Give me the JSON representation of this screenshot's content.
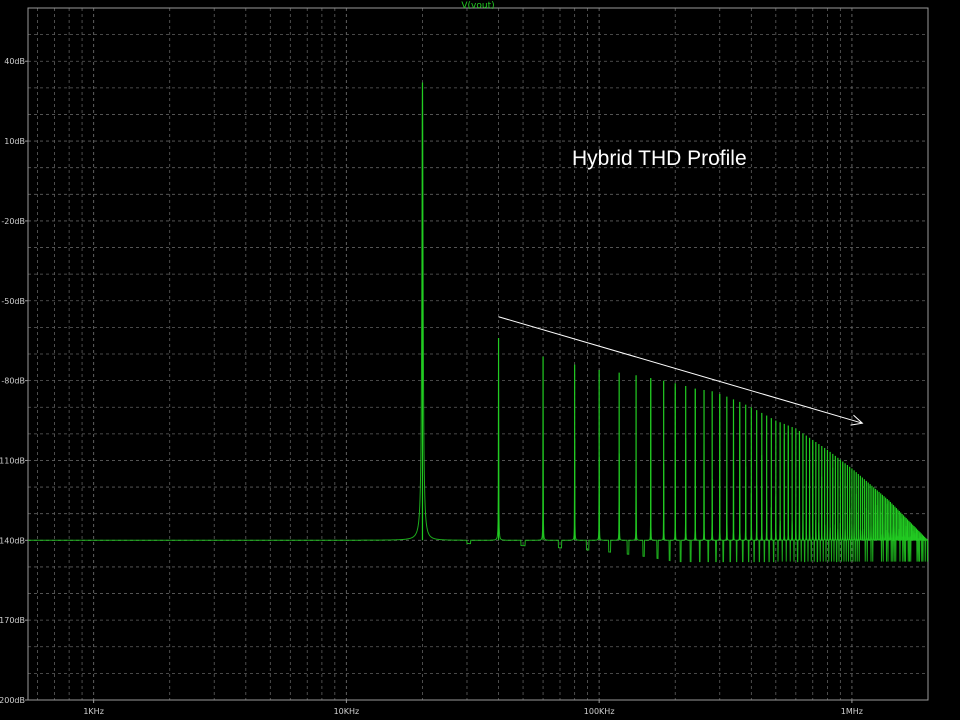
{
  "chart_data": {
    "type": "line",
    "title": "",
    "trace_label": "V(vout)",
    "annotation": "Hybrid THD Profile",
    "xscale": "log",
    "xlim": [
      550,
      2000000
    ],
    "ylim": [
      -200,
      60
    ],
    "grid": true,
    "x_ticks": [
      {
        "value": 1000,
        "label": "1KHz"
      },
      {
        "value": 10000,
        "label": "10KHz"
      },
      {
        "value": 100000,
        "label": "100KHz"
      },
      {
        "value": 1000000,
        "label": "1MHz"
      }
    ],
    "y_ticks": [
      {
        "value": 40,
        "label": "40dB"
      },
      {
        "value": 10,
        "label": "10dB"
      },
      {
        "value": -20,
        "label": "-20dB"
      },
      {
        "value": -50,
        "label": "-50dB"
      },
      {
        "value": -80,
        "label": "-80dB"
      },
      {
        "value": -110,
        "label": "-110dB"
      },
      {
        "value": -140,
        "label": "-140dB"
      },
      {
        "value": -170,
        "label": "-170dB"
      },
      {
        "value": -200,
        "label": "-200dB"
      }
    ],
    "fundamental": {
      "freq": 20000,
      "level": 32
    },
    "harmonic_spacing": 20000,
    "noise_floor": -140,
    "harmonics": [
      {
        "freq": 40000,
        "level": -64
      },
      {
        "freq": 60000,
        "level": -71
      },
      {
        "freq": 80000,
        "level": -74
      },
      {
        "freq": 100000,
        "level": -76
      },
      {
        "freq": 120000,
        "level": -77
      },
      {
        "freq": 140000,
        "level": -78
      },
      {
        "freq": 160000,
        "level": -79
      },
      {
        "freq": 180000,
        "level": -80
      },
      {
        "freq": 200000,
        "level": -81
      },
      {
        "freq": 240000,
        "level": -83
      },
      {
        "freq": 280000,
        "level": -84
      },
      {
        "freq": 320000,
        "level": -86
      },
      {
        "freq": 360000,
        "level": -88
      },
      {
        "freq": 400000,
        "level": -90
      },
      {
        "freq": 500000,
        "level": -95
      },
      {
        "freq": 600000,
        "level": -98
      },
      {
        "freq": 800000,
        "level": -106
      },
      {
        "freq": 1000000,
        "level": -113
      },
      {
        "freq": 1400000,
        "level": -125
      },
      {
        "freq": 2000000,
        "level": -140
      }
    ],
    "trend_arrow": {
      "from": {
        "freq": 40000,
        "level": -56
      },
      "to": {
        "freq": 1100000,
        "level": -96
      }
    },
    "colors": {
      "trace": "#22cc22",
      "grid": "#606060",
      "axis_text": "#d0d0d0",
      "annotation": "#ffffff",
      "background": "#000000"
    }
  }
}
